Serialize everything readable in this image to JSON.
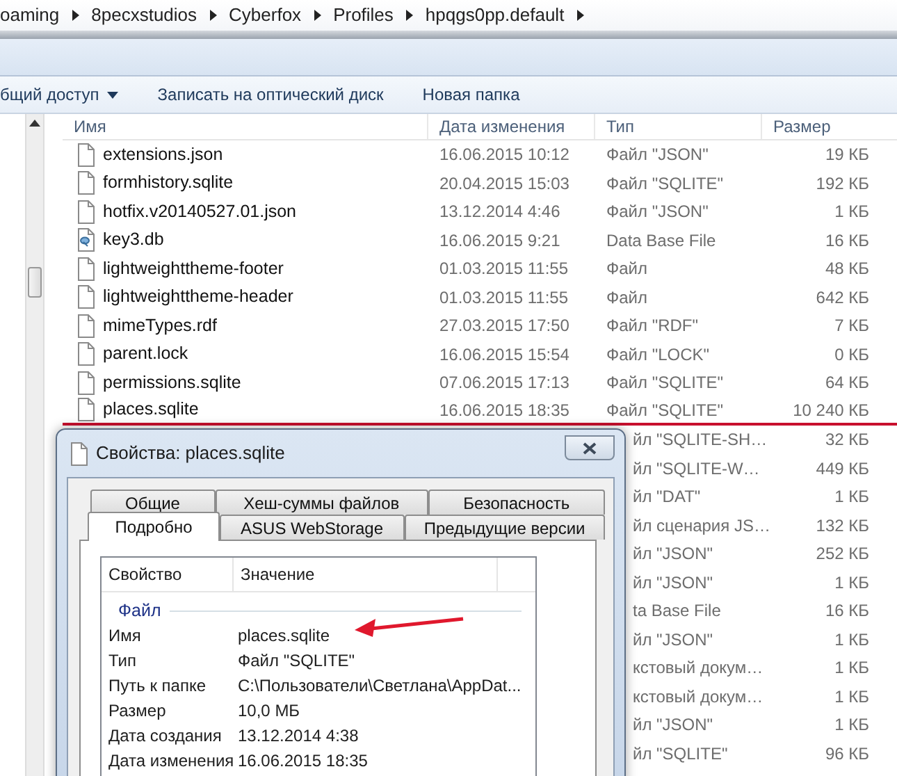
{
  "address_bar": {
    "crumbs": [
      "oaming",
      "8pecxstudios",
      "Cyberfox",
      "Profiles",
      "hpqgs0pp.default"
    ]
  },
  "command_bar": [
    {
      "label": "бщий доступ",
      "dropdown": true
    },
    {
      "label": "Записать на оптический диск",
      "dropdown": false
    },
    {
      "label": "Новая папка",
      "dropdown": false
    }
  ],
  "file_list": {
    "columns": [
      "Имя",
      "Дата изменения",
      "Тип",
      "Размер"
    ],
    "rows": [
      {
        "kind": "file",
        "name": "extensions.json",
        "date": "16.06.2015 10:12",
        "type": "Файл \"JSON\"",
        "size": "19 КБ",
        "selected": false
      },
      {
        "kind": "file",
        "name": "formhistory.sqlite",
        "date": "20.04.2015 15:03",
        "type": "Файл \"SQLITE\"",
        "size": "192 КБ",
        "selected": false
      },
      {
        "kind": "file",
        "name": "hotfix.v20140527.01.json",
        "date": "13.12.2014 4:46",
        "type": "Файл \"JSON\"",
        "size": "1 КБ",
        "selected": false
      },
      {
        "kind": "database",
        "name": "key3.db",
        "date": "16.06.2015 9:21",
        "type": "Data Base File",
        "size": "16 КБ",
        "selected": false
      },
      {
        "kind": "file",
        "name": "lightweighttheme-footer",
        "date": "01.03.2015 11:55",
        "type": "Файл",
        "size": "48 КБ",
        "selected": false
      },
      {
        "kind": "file",
        "name": "lightweighttheme-header",
        "date": "01.03.2015 11:55",
        "type": "Файл",
        "size": "642 КБ",
        "selected": false
      },
      {
        "kind": "file",
        "name": "mimeTypes.rdf",
        "date": "27.03.2015 17:50",
        "type": "Файл \"RDF\"",
        "size": "7 КБ",
        "selected": false
      },
      {
        "kind": "file",
        "name": "parent.lock",
        "date": "16.06.2015 15:54",
        "type": "Файл \"LOCK\"",
        "size": "0 КБ",
        "selected": false
      },
      {
        "kind": "file",
        "name": "permissions.sqlite",
        "date": "07.06.2015 17:13",
        "type": "Файл \"SQLITE\"",
        "size": "64 КБ",
        "selected": false
      },
      {
        "kind": "file",
        "name": "places.sqlite",
        "date": "16.06.2015 18:35",
        "type": "Файл \"SQLITE\"",
        "size": "10 240 КБ",
        "selected": true
      },
      {
        "kind": "covered",
        "type": "йл \"SQLITE-SH…",
        "size": "32 КБ",
        "selected": false
      },
      {
        "kind": "covered",
        "type": "йл \"SQLITE-W…",
        "size": "449 КБ",
        "selected": false
      },
      {
        "kind": "covered",
        "type": "йл \"DAT\"",
        "size": "1 КБ",
        "selected": false
      },
      {
        "kind": "covered",
        "type": "йл сценария JS…",
        "size": "132 КБ",
        "selected": false
      },
      {
        "kind": "covered",
        "type": "йл \"JSON\"",
        "size": "252 КБ",
        "selected": false
      },
      {
        "kind": "covered",
        "type": "йл \"JSON\"",
        "size": "1 КБ",
        "selected": false
      },
      {
        "kind": "covered",
        "type": "ta Base File",
        "size": "16 КБ",
        "selected": false
      },
      {
        "kind": "covered",
        "type": "йл \"JSON\"",
        "size": "1 КБ",
        "selected": false
      },
      {
        "kind": "covered",
        "type": "кстовый докум…",
        "size": "1 КБ",
        "selected": false
      },
      {
        "kind": "covered",
        "type": "кстовый докум…",
        "size": "1 КБ",
        "selected": false
      },
      {
        "kind": "covered",
        "type": "йл \"JSON\"",
        "size": "1 КБ",
        "selected": false
      },
      {
        "kind": "covered",
        "type": "йл \"SQLITE\"",
        "size": "96 КБ",
        "selected": false
      }
    ]
  },
  "properties_dialog": {
    "title": "Свойства: places.sqlite",
    "tab_rows": [
      [
        {
          "label": "Общие",
          "selected": false
        },
        {
          "label": "Хеш-суммы файлов",
          "selected": false
        },
        {
          "label": "Безопасность",
          "selected": false
        }
      ],
      [
        {
          "label": "Подробно",
          "selected": true
        },
        {
          "label": "ASUS WebStorage",
          "selected": false
        },
        {
          "label": "Предыдущие версии",
          "selected": false
        }
      ]
    ],
    "columns": [
      "Свойство",
      "Значение"
    ],
    "group": "Файл",
    "properties": [
      {
        "name": "Имя",
        "value": "places.sqlite",
        "highlighted": true
      },
      {
        "name": "Тип",
        "value": "Файл \"SQLITE\"",
        "highlighted": false
      },
      {
        "name": "Путь к папке",
        "value": "C:\\Пользователи\\Светлана\\AppDat...",
        "highlighted": false
      },
      {
        "name": "Размер",
        "value": "10,0 МБ",
        "highlighted": false
      },
      {
        "name": "Дата создания",
        "value": "13.12.2014 4:38",
        "highlighted": false
      },
      {
        "name": "Дата изменения",
        "value": "16.06.2015 18:35",
        "highlighted": false
      }
    ]
  }
}
